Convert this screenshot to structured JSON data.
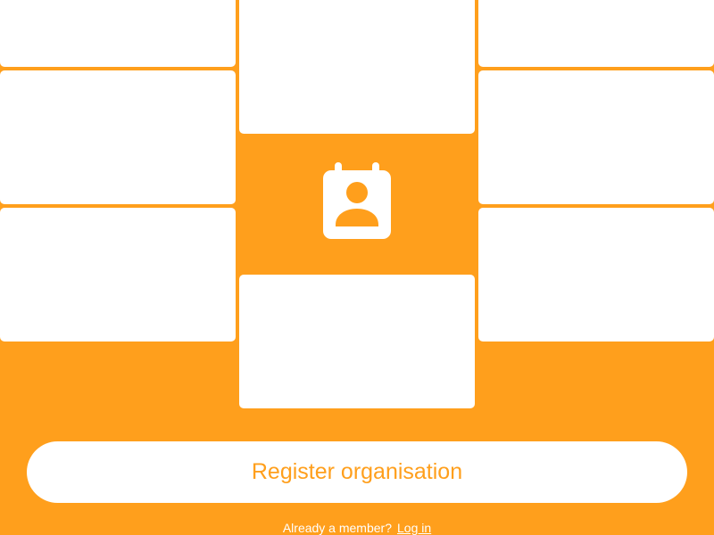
{
  "theme": {
    "accent_color": "#FF9F1C",
    "card_color": "#FFFFFF"
  },
  "hero": {
    "icon": "contact-calendar-icon"
  },
  "register_button": {
    "label": "Register organisation"
  },
  "login": {
    "prompt": "Already a member?",
    "link_label": "Log in"
  }
}
